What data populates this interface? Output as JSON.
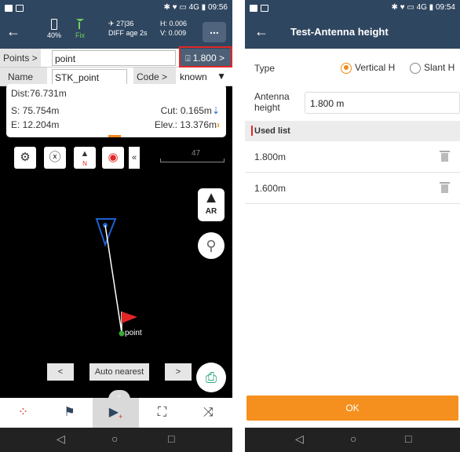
{
  "left": {
    "status": {
      "time": "09:56",
      "network": "4G"
    },
    "header": {
      "battery": "40%",
      "fix": "Fix",
      "sats": "27|36",
      "diff_age": "DIFF age 2s",
      "h_precision": "H: 0.006",
      "v_precision": "V: 0.009",
      "more": "..."
    },
    "points_label": "Points >",
    "points_value": "point",
    "antenna_height_btn": "1.800 >",
    "name_label": "Name",
    "name_value": "STK_point",
    "code_label": "Code >",
    "code_value": "known",
    "info": {
      "dist": "Dist:76.731m",
      "s_label": "S: ",
      "s_value": "75.754m",
      "e_label": "E: ",
      "e_value": "12.204m",
      "cut_label": "Cut: ",
      "cut_value": "0.165m",
      "elev_label": "Elev.: ",
      "elev_value": "13.376m"
    },
    "scale": "47",
    "ar_label": "AR",
    "target_label": "point",
    "nav": {
      "prev": "<",
      "mode": "Auto nearest",
      "next": ">"
    }
  },
  "right": {
    "status": {
      "time": "09:54",
      "network": "4G"
    },
    "title": "Test-Antenna height",
    "type_label": "Type",
    "type_options": [
      "Vertical H",
      "Slant H"
    ],
    "type_selected": "Vertical H",
    "ah_label_line1": "Antenna",
    "ah_label_line2": "height",
    "ah_value": "1.800 m",
    "used_list_label": "Used list",
    "used_list": [
      "1.800m",
      "1.600m"
    ],
    "ok_label": "OK"
  },
  "colors": {
    "header_bg": "#2f4660",
    "accent_orange": "#f5901e",
    "highlight_red": "#e22626",
    "fix_green": "#6fd35a",
    "link_blue": "#2a6bd4"
  }
}
